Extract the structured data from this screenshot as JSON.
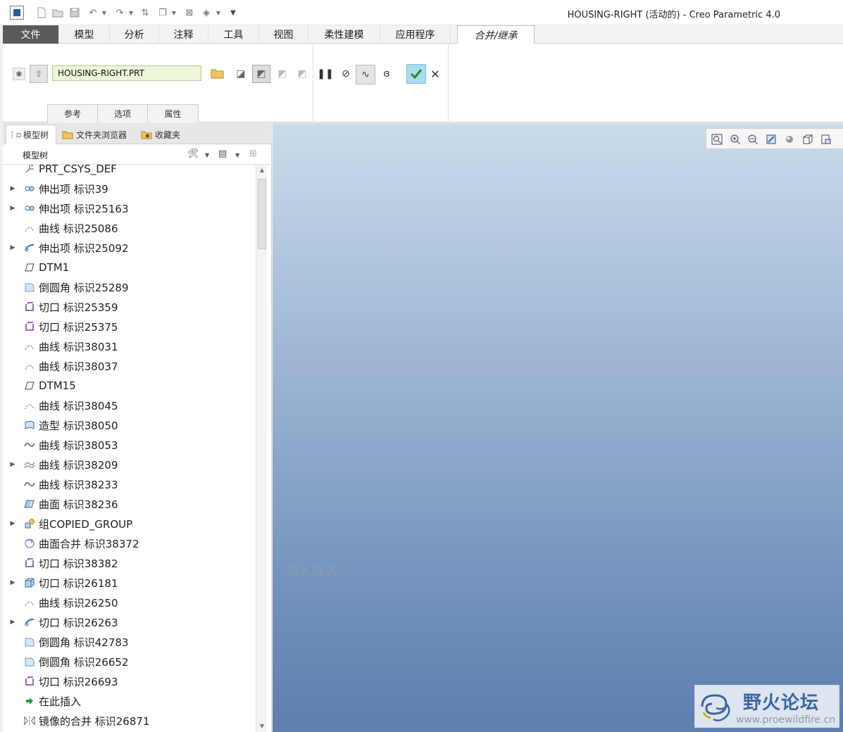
{
  "window": {
    "title": "HOUSING-RIGHT (活动的) - Creo Parametric 4.0"
  },
  "ribbon_tabs": [
    {
      "label": "文件"
    },
    {
      "label": "模型"
    },
    {
      "label": "分析"
    },
    {
      "label": "注释"
    },
    {
      "label": "工具"
    },
    {
      "label": "视图"
    },
    {
      "label": "柔性建模"
    },
    {
      "label": "应用程序"
    },
    {
      "label": "合并/继承"
    }
  ],
  "ribbon": {
    "reference_file": "HOUSING-RIGHT.PRT",
    "sub_tabs": [
      {
        "label": "参考"
      },
      {
        "label": "选项"
      },
      {
        "label": "属性"
      }
    ]
  },
  "navigator": {
    "tabs": [
      {
        "label": "模型树"
      },
      {
        "label": "文件夹浏览器"
      },
      {
        "label": "收藏夹"
      }
    ],
    "tree_title": "模型树",
    "items": [
      {
        "label": "PRT_CSYS_DEF",
        "icon": "csys-icon",
        "expand": false
      },
      {
        "label": "伸出项 标识39",
        "icon": "protrusion-icon",
        "expand": true
      },
      {
        "label": "伸出项 标识25163",
        "icon": "protrusion-icon",
        "expand": true
      },
      {
        "label": "曲线 标识25086",
        "icon": "curve-icon",
        "expand": false
      },
      {
        "label": "伸出项 标识25092",
        "icon": "sweep-icon",
        "expand": true
      },
      {
        "label": "DTM1",
        "icon": "datum-plane-icon",
        "expand": false
      },
      {
        "label": "倒圆角 标识25289",
        "icon": "round-icon",
        "expand": false
      },
      {
        "label": "切口 标识25359",
        "icon": "cut-icon",
        "expand": false
      },
      {
        "label": "切口 标识25375",
        "icon": "cut-icon",
        "expand": false
      },
      {
        "label": "曲线 标识38031",
        "icon": "curve-icon",
        "expand": false
      },
      {
        "label": "曲线 标识38037",
        "icon": "curve-icon",
        "expand": false
      },
      {
        "label": "DTM15",
        "icon": "datum-plane-icon",
        "expand": false
      },
      {
        "label": "曲线 标识38045",
        "icon": "curve-icon",
        "expand": false
      },
      {
        "label": "造型 标识38050",
        "icon": "style-icon",
        "expand": false
      },
      {
        "label": "曲线 标识38053",
        "icon": "spline-icon",
        "expand": false
      },
      {
        "label": "曲线 标识38209",
        "icon": "curve-group-icon",
        "expand": true
      },
      {
        "label": "曲线 标识38233",
        "icon": "spline-icon",
        "expand": false
      },
      {
        "label": "曲面 标识38236",
        "icon": "surface-icon",
        "expand": false
      },
      {
        "label": "组COPIED_GROUP",
        "icon": "group-icon",
        "expand": true
      },
      {
        "label": "曲面合并 标识38372",
        "icon": "merge-icon",
        "expand": false
      },
      {
        "label": "切口 标识38382",
        "icon": "cut-icon",
        "expand": false
      },
      {
        "label": "切口 标识26181",
        "icon": "solid-cut-icon",
        "expand": true
      },
      {
        "label": "曲线 标识26250",
        "icon": "curve-icon",
        "expand": false
      },
      {
        "label": "切口 标识26263",
        "icon": "sweep-icon",
        "expand": true
      },
      {
        "label": "倒圆角 标识42783",
        "icon": "round-icon",
        "expand": false
      },
      {
        "label": "倒圆角 标识26652",
        "icon": "round-icon",
        "expand": false
      },
      {
        "label": "切口 标识26693",
        "icon": "cut-icon",
        "expand": false
      },
      {
        "label": "在此插入",
        "icon": "insert-here-icon",
        "expand": false
      },
      {
        "label": "镜像的合并 标识26871",
        "icon": "mirror-merge-icon",
        "expand": false
      }
    ]
  },
  "viewport": {
    "status_text": "插入模式"
  },
  "watermark": {
    "main": "野火论坛",
    "sub": "www.proewildfire.cn"
  }
}
